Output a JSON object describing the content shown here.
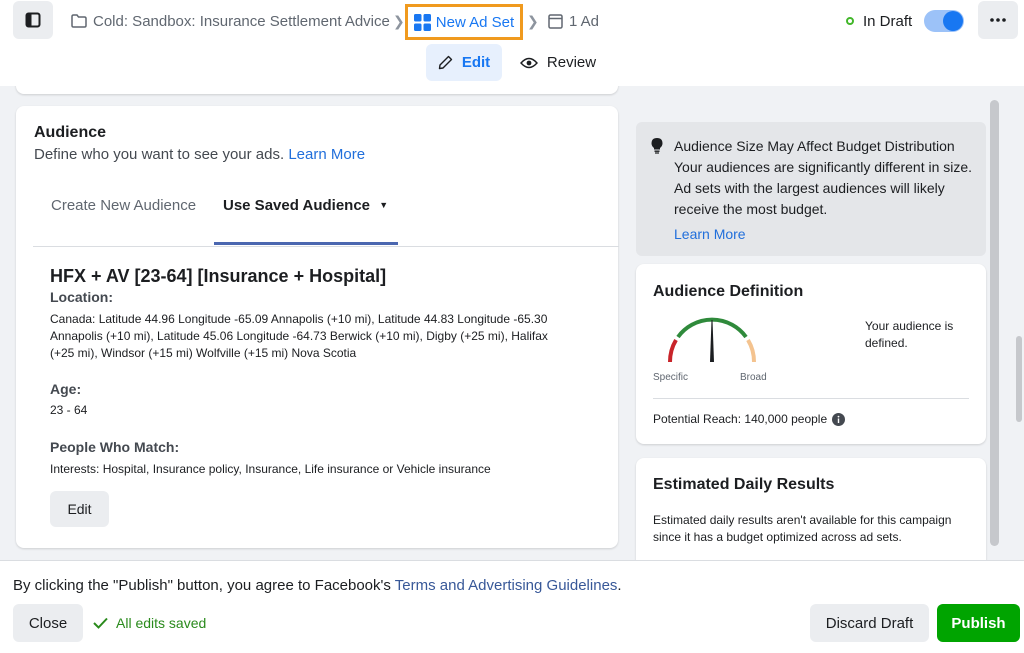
{
  "header": {
    "breadcrumb_campaign": "Cold: Sandbox: Insurance Settlement Advice",
    "breadcrumb_adset": "New Ad Set",
    "breadcrumb_ad": "1 Ad",
    "status": "In Draft",
    "toggle_on": true
  },
  "modes": {
    "edit": "Edit",
    "review": "Review"
  },
  "audience": {
    "title": "Audience",
    "subtitle": "Define who you want to see your ads.",
    "learn_more": "Learn More",
    "tabs": [
      {
        "label": "Create New Audience",
        "active": false
      },
      {
        "label": "Use Saved Audience",
        "active": true
      }
    ],
    "name": "HFX + AV [23-64] [Insurance + Hospital]",
    "location_label": "Location:",
    "location_value": "Canada: Latitude 44.96 Longitude -65.09 Annapolis (+10 mi), Latitude 44.83 Longitude -65.30 Annapolis (+10 mi), Latitude 45.06 Longitude -64.73 Berwick (+10 mi), Digby (+25 mi), Halifax (+25 mi), Windsor (+15 mi) Wolfville (+15 mi) Nova Scotia",
    "age_label": "Age:",
    "age_value": "23 - 64",
    "match_label": "People Who Match:",
    "match_value": "Interests: Hospital, Insurance policy, Insurance, Life insurance or Vehicle insurance",
    "edit_button": "Edit"
  },
  "info_notice": {
    "title": "Audience Size May Affect Budget Distribution",
    "body": "Your audiences are significantly different in size. Ad sets with the largest audiences will likely receive the most budget.",
    "learn_more": "Learn More"
  },
  "definition": {
    "title": "Audience Definition",
    "status_text": "Your audience is defined.",
    "specific_label": "Specific",
    "broad_label": "Broad",
    "potential_reach": "Potential Reach: 140,000 people"
  },
  "estimated": {
    "title": "Estimated Daily Results",
    "body": "Estimated daily results aren't available for this campaign since it has a budget optimized across ad sets."
  },
  "footer": {
    "terms_prefix": "By clicking the \"Publish\" button, you agree to Facebook's ",
    "terms_link": "Terms and Advertising Guidelines",
    "terms_suffix": ".",
    "close": "Close",
    "saved": "All edits saved",
    "discard": "Discard Draft",
    "publish": "Publish"
  },
  "colors": {
    "accent": "#1877f2",
    "publish_green": "#00a400",
    "highlight_border": "#f09a1e"
  }
}
